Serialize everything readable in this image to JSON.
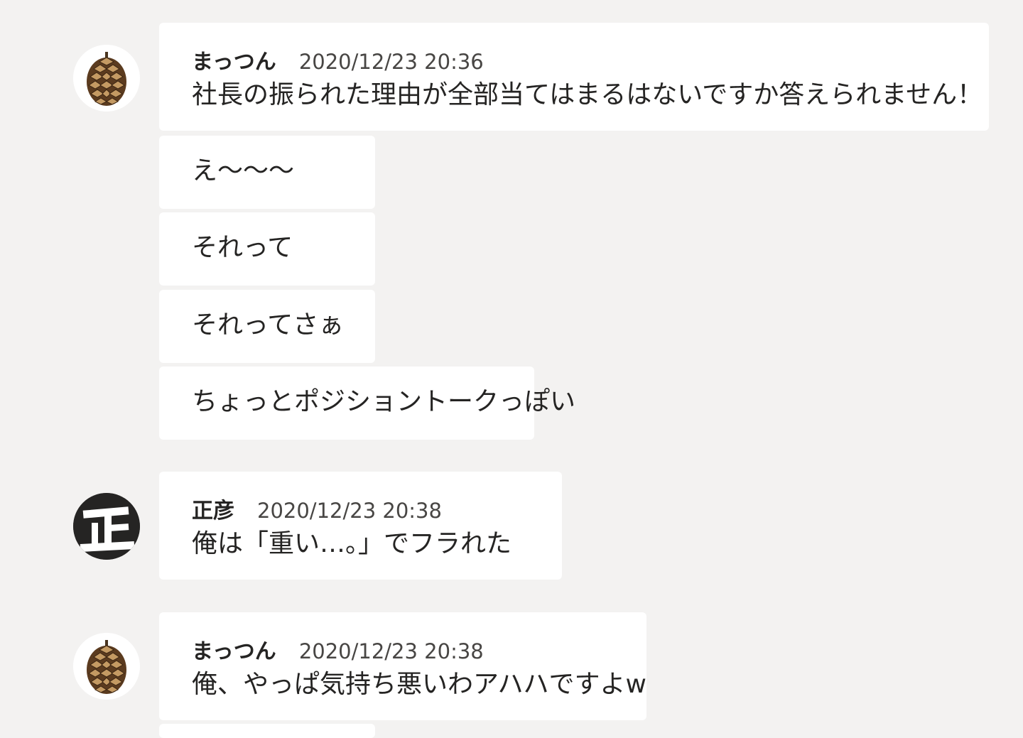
{
  "messages": [
    {
      "author": "まっつん",
      "timestamp": "2020/12/23 20:36",
      "avatar_icon": "pinecone-icon",
      "lines": [
        "社長の振られた理由が全部当てはまるはないですか答えられません！",
        "え〜〜〜",
        "それって",
        "それってさぁ",
        "ちょっとポジショントークっぽい"
      ]
    },
    {
      "author": "正彦",
      "timestamp": "2020/12/23 20:38",
      "avatar_icon": "masahiko-kanji-avatar-icon",
      "avatar_text": "正",
      "lines": [
        "俺は「重い…。」でフラれた"
      ]
    },
    {
      "author": "まっつん",
      "timestamp": "2020/12/23 20:38",
      "avatar_icon": "pinecone-icon",
      "lines": [
        "俺、やっぱ気持ち悪いわアハハですよw"
      ]
    }
  ],
  "colors": {
    "background": "#f3f2f1",
    "bubble": "#ffffff",
    "text": "#252423",
    "timestamp": "#484644",
    "avatar_dark": "#252423"
  }
}
